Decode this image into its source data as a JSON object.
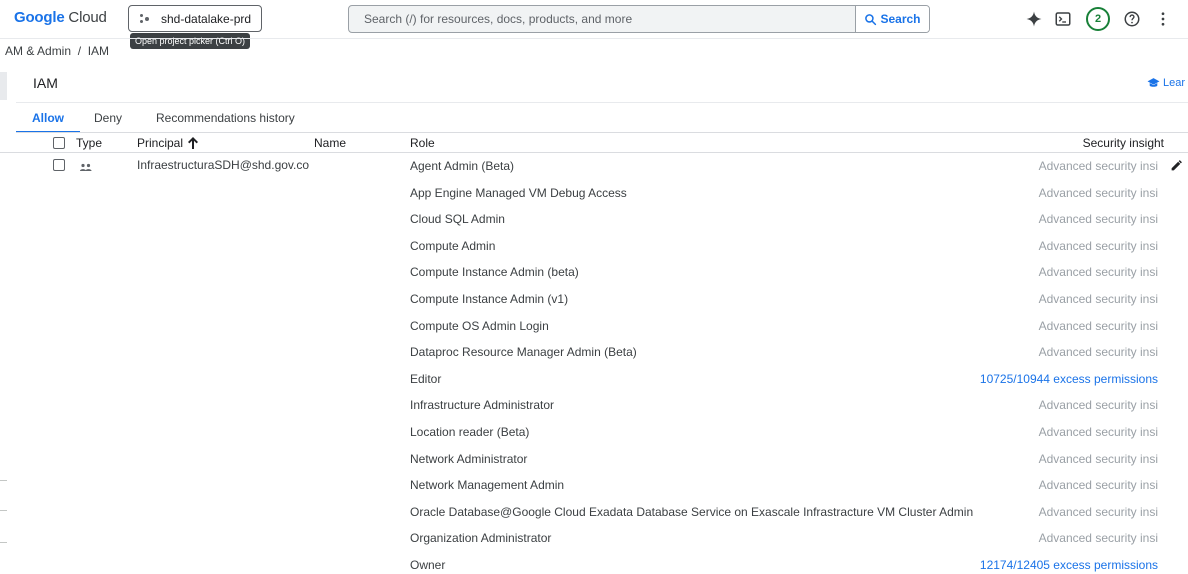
{
  "header": {
    "logo_brand": "Google",
    "logo_product": " Cloud",
    "project_name": "shd-datalake-prd",
    "project_tooltip": "Open project picker (Ctrl O)",
    "search_placeholder": "Search (/) for resources, docs, products, and more",
    "search_button": "Search",
    "notifications_count": "2",
    "icons": [
      "gemini-sparkle-icon",
      "cloud-shell-icon",
      "help-icon",
      "more-vert-icon"
    ]
  },
  "breadcrumb": "AM & Admin  /  IAM",
  "panel": {
    "title": "IAM",
    "learn_link": "Lear"
  },
  "tabs": [
    {
      "label": "Allow",
      "active": true
    },
    {
      "label": "Deny",
      "active": false
    },
    {
      "label": "Recommendations history",
      "active": false
    }
  ],
  "table": {
    "columns": {
      "type": "Type",
      "principal": "Principal",
      "name": "Name",
      "role": "Role",
      "insight": "Security insight"
    },
    "principal": "InfraestructuraSDH@shd.gov.co",
    "rows": [
      {
        "role": "Agent Admin (Beta)",
        "insight": "Advanced security insi",
        "link": false
      },
      {
        "role": "App Engine Managed VM Debug Access",
        "insight": "Advanced security insi",
        "link": false
      },
      {
        "role": "Cloud SQL Admin",
        "insight": "Advanced security insi",
        "link": false
      },
      {
        "role": "Compute Admin",
        "insight": "Advanced security insi",
        "link": false
      },
      {
        "role": "Compute Instance Admin (beta)",
        "insight": "Advanced security insi",
        "link": false
      },
      {
        "role": "Compute Instance Admin (v1)",
        "insight": "Advanced security insi",
        "link": false
      },
      {
        "role": "Compute OS Admin Login",
        "insight": "Advanced security insi",
        "link": false
      },
      {
        "role": "Dataproc Resource Manager Admin (Beta)",
        "insight": "Advanced security insi",
        "link": false
      },
      {
        "role": "Editor",
        "insight": "10725/10944 excess permissions",
        "link": true
      },
      {
        "role": "Infrastructure Administrator",
        "insight": "Advanced security insi",
        "link": false
      },
      {
        "role": "Location reader (Beta)",
        "insight": "Advanced security insi",
        "link": false
      },
      {
        "role": "Network Administrator",
        "insight": "Advanced security insi",
        "link": false
      },
      {
        "role": "Network Management Admin",
        "insight": "Advanced security insi",
        "link": false
      },
      {
        "role": "Oracle Database@Google Cloud Exadata Database Service on Exascale Infrastracture VM Cluster Admin",
        "insight": "Advanced security insi",
        "link": false
      },
      {
        "role": "Organization Administrator",
        "insight": "Advanced security insi",
        "link": false
      },
      {
        "role": "Owner",
        "insight": "12174/12405 excess permissions",
        "link": true
      }
    ]
  },
  "colors": {
    "accent": "#1a73e8",
    "notification": "#188038",
    "muted": "#9aa0a6"
  }
}
